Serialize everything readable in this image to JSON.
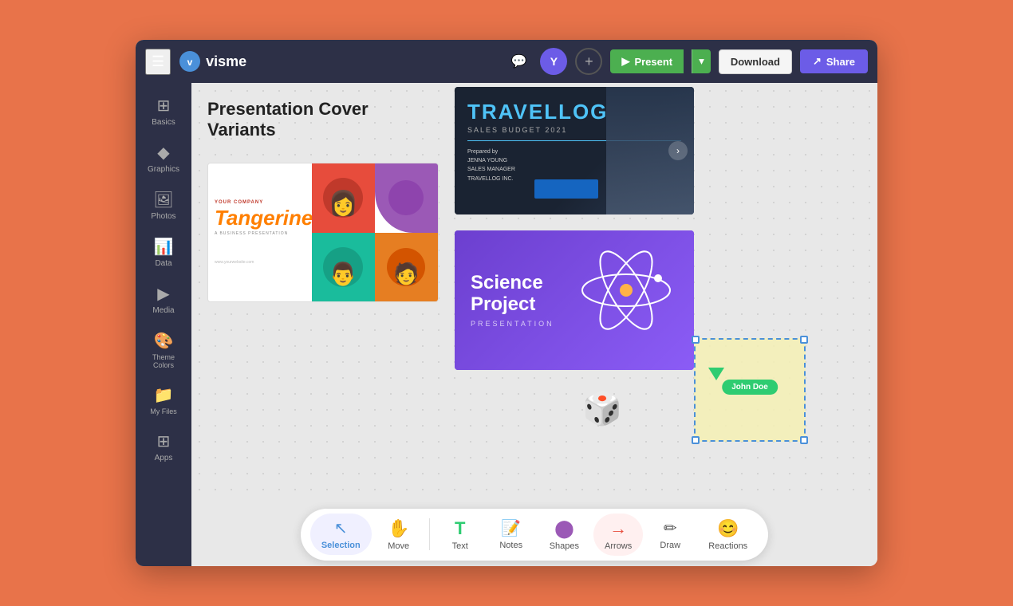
{
  "header": {
    "menu_icon": "☰",
    "logo_text": "visme",
    "comment_icon": "💬",
    "avatar_initials": "Y",
    "plus_icon": "+",
    "present_label": "Present",
    "present_arrow": "▾",
    "download_label": "Download",
    "share_icon": "↗",
    "share_label": "Share"
  },
  "sidebar": {
    "items": [
      {
        "id": "basics",
        "label": "Basics",
        "icon": "⊞"
      },
      {
        "id": "graphics",
        "label": "Graphics",
        "icon": "🔷"
      },
      {
        "id": "photos",
        "label": "Photos",
        "icon": "🖼"
      },
      {
        "id": "data",
        "label": "Data",
        "icon": "📊"
      },
      {
        "id": "media",
        "label": "Media",
        "icon": "▶"
      },
      {
        "id": "theme-colors",
        "label": "Theme Colors",
        "icon": "🎨"
      },
      {
        "id": "my-files",
        "label": "My Files",
        "icon": "📁"
      },
      {
        "id": "apps",
        "label": "Apps",
        "icon": "⊞"
      }
    ]
  },
  "canvas": {
    "slide_title_line1": "Presentation Cover",
    "slide_title_line2": "Variants",
    "tangerine": {
      "brand": "YOUR COMPANY",
      "title": "Tangerine",
      "subtitle": "A BUSINESS PRESENTATION",
      "url": "www.yourwebsite.com"
    },
    "travellog": {
      "title": "TRAVELLOG",
      "subtitle": "SALES BUDGET 2021",
      "prepared_by": "Prepared by",
      "name": "JENNA YOUNG",
      "role": "SALES MANAGER",
      "company": "TRAVELLOG INC."
    },
    "science": {
      "title_line1": "Science",
      "title_line2": "Project",
      "subtitle": "PRESENTATION"
    },
    "selected_card": {
      "label": "John Doe"
    }
  },
  "toolbar": {
    "items": [
      {
        "id": "selection",
        "label": "Selection",
        "icon": "↖",
        "active": true
      },
      {
        "id": "move",
        "label": "Move",
        "icon": "✋"
      },
      {
        "id": "text",
        "label": "Text",
        "icon": "T"
      },
      {
        "id": "notes",
        "label": "Notes",
        "icon": "📝"
      },
      {
        "id": "shapes",
        "label": "Shapes",
        "icon": "⬤"
      },
      {
        "id": "arrows",
        "label": "Arrows",
        "icon": "→",
        "arrows_active": true
      },
      {
        "id": "draw",
        "label": "Draw",
        "icon": "✏"
      },
      {
        "id": "reactions",
        "label": "Reactions",
        "icon": "😊"
      }
    ]
  }
}
